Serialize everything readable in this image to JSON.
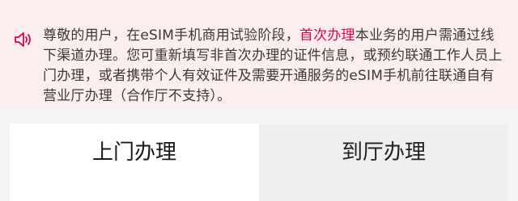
{
  "notice": {
    "icon": "speaker-icon",
    "text_before": "尊敬的用户，在eSIM手机商用试验阶段，",
    "highlight": "首次办理",
    "text_after": "本业务的用户需通过线下渠道办理。您可重新填写非首次办理的证件信息，或预约联通工作人员上门办理，或者携带个人有效证件及需要开通服务的eSIM手机前往联通自有营业厅办理（合作厅不支持）。",
    "highlight_color": "#e5004f"
  },
  "tabs": [
    {
      "label": "上门办理",
      "active": true
    },
    {
      "label": "到厅办理",
      "active": false
    }
  ]
}
